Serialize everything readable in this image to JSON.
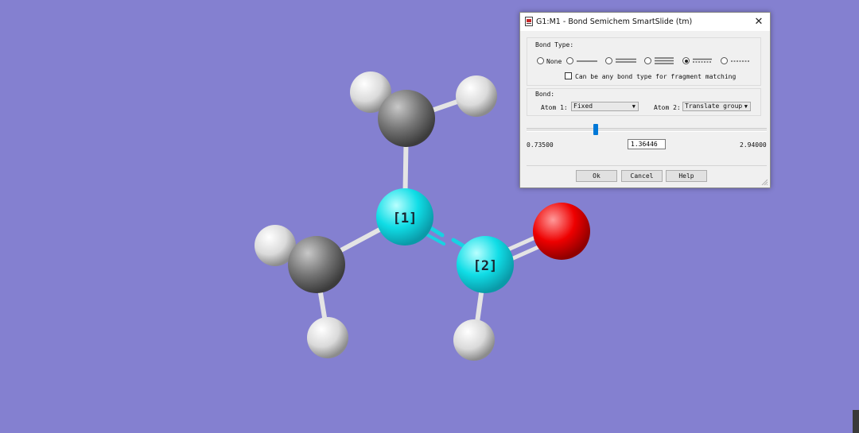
{
  "molecule": {
    "atom_labels": [
      "[1]",
      "[2]"
    ],
    "colors": {
      "background": "#8480d0",
      "carbon": "#7a7a7a",
      "hydrogen": "#e8e8e8",
      "nitrogen": "#10dde6",
      "oxygen": "#ee0000",
      "bond": "#e4e4e4",
      "highlight_bond": "#18d2e2"
    }
  },
  "dialog": {
    "title": "G1:M1 - Bond Semichem SmartSlide (tm)",
    "close_glyph": "✕",
    "bond_type": {
      "group_label": "Bond Type:",
      "none_label": "None",
      "options": [
        "none",
        "single",
        "double",
        "triple",
        "aromatic",
        "partial"
      ],
      "selected": "aromatic",
      "fragment_checkbox_label": "Can be any bond type for fragment matching",
      "fragment_checkbox_checked": false
    },
    "bond": {
      "group_label": "Bond:",
      "atom1_label": "Atom 1:",
      "atom1_value": "Fixed",
      "atom2_label": "Atom 2:",
      "atom2_value": "Translate group"
    },
    "slider": {
      "min": "0.73500",
      "max": "2.94000",
      "value": "1.36446",
      "fraction": 0.285
    },
    "buttons": {
      "ok": "Ok",
      "cancel": "Cancel",
      "help": "Help"
    }
  }
}
